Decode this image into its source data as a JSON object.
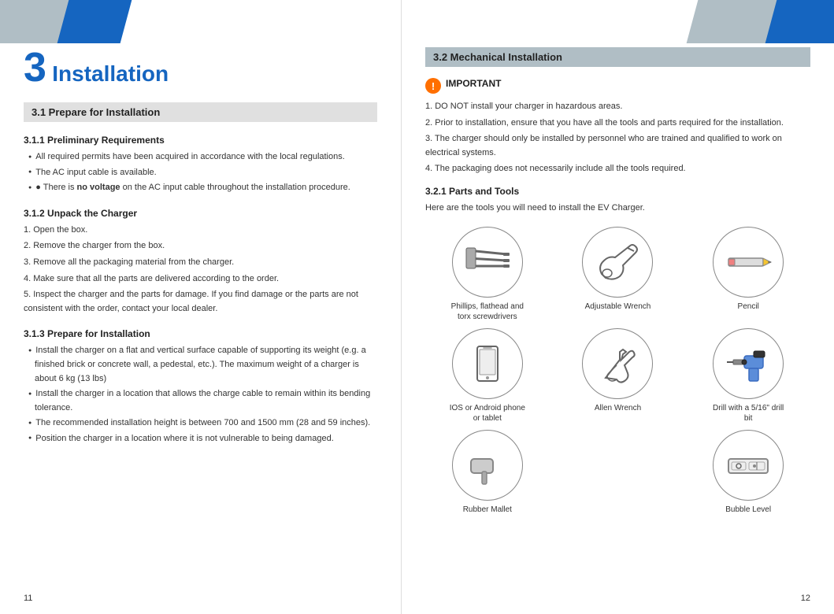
{
  "left_page": {
    "page_number": "11",
    "chapter": {
      "number": "3",
      "title": "Installation"
    },
    "section_1": {
      "heading": "3.1 Prepare for Installation",
      "subsection_1_1": {
        "heading": "3.1.1 Preliminary Requirements",
        "bullets": [
          "All required permits have been acquired in accordance with the local regulations.",
          "The AC input cable is available.",
          "There is no voltage on the AC input cable throughout the installation procedure."
        ],
        "bold_phrase": "no voltage"
      },
      "subsection_1_2": {
        "heading": "3.1.2 Unpack the Charger",
        "items": [
          "1. Open the box.",
          "2. Remove the charger from the box.",
          "3. Remove all the packaging material from the charger.",
          "4. Make sure that all the parts are delivered according to the order.",
          "5. Inspect the charger and the parts for damage. If you find damage or the parts are not consistent with the order, contact your local dealer."
        ]
      },
      "subsection_1_3": {
        "heading": "3.1.3 Prepare for Installation",
        "bullets": [
          "Install the charger on a flat and vertical surface capable of supporting its weight (e.g. a finished brick or concrete wall, a pedestal, etc.). The maximum weight of a charger is about 6 kg (13 lbs)",
          "Install the charger in a location that allows the charge cable to remain within its bending tolerance.",
          "The recommended installation height is between 700 and 1500 mm (28 and 59 inches).",
          "Position the charger in a location where it is not vulnerable to being damaged."
        ]
      }
    }
  },
  "right_page": {
    "page_number": "12",
    "section_2": {
      "heading": "3.2 Mechanical Installation",
      "important": {
        "label": "IMPORTANT",
        "items": [
          "1. DO NOT install your charger in hazardous areas.",
          "2. Prior to installation, ensure that you have all the tools and parts required for the installation.",
          "3. The charger should only be installed by personnel who are trained and qualified to work on electrical systems.",
          "4. The packaging does not necessarily include all the tools required."
        ]
      },
      "subsection_2_1": {
        "heading": "3.2.1 Parts and Tools",
        "intro": "Here are the tools you will need to install the EV Charger.",
        "tools": [
          {
            "id": "screwdrivers",
            "label": "Phillips, flathead and\ntorx screwdrivers"
          },
          {
            "id": "adjustable-wrench",
            "label": "Adjustable Wrench"
          },
          {
            "id": "pencil",
            "label": "Pencil"
          },
          {
            "id": "phone",
            "label": "IOS or Android phone\nor tablet"
          },
          {
            "id": "wrench",
            "label": "Wrench"
          },
          {
            "id": "drill",
            "label": "Drill with a 5/16\" drill bit"
          },
          {
            "id": "rubber-mallet",
            "label": "Rubber Mallet"
          },
          {
            "id": "allen-wrench",
            "label": "Allen Wrench"
          },
          {
            "id": "bubble-level",
            "label": "Bubble Level"
          }
        ]
      }
    }
  }
}
